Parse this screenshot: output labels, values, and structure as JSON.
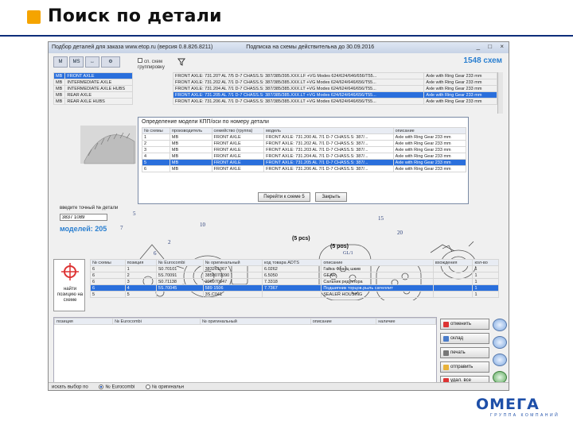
{
  "slide": {
    "title": "Поиск по детали"
  },
  "window": {
    "title": "Подбор деталей для заказа www.etop.ru (версия 0.8.826.8211)",
    "subtitle": "Подписка на схемы действительна до 30.09.2016",
    "controls": "_ □ ×",
    "schemes_count": "1548 схем",
    "checkbox_label": "сп. схем группировку",
    "toolbar": [
      "M",
      "MS",
      "↔",
      "⚙"
    ]
  },
  "left_list": [
    {
      "code": "MB",
      "name": "FRONT AXLE",
      "selected": true
    },
    {
      "code": "MB",
      "name": "INTERMEDIATE AXLE"
    },
    {
      "code": "MB",
      "name": "INTERMEDIATE AXLE HUBS"
    },
    {
      "code": "MB",
      "name": "REAR AXLE"
    },
    {
      "code": "MB",
      "name": "REAR AXLE HUBS"
    }
  ],
  "top_list": [
    {
      "model": "FRONT AXLE: 731.20? AL 7/5 D-7 CHASS.S: 387/385/395.XXX.LF +VG Modes 624/624/646/656/T55...",
      "desc": "Axle with Ring Gear 233 mm"
    },
    {
      "model": "FRONT AXLE: 731.202 AL 7/1 D-7 CHASS.S: 387/385/385.XXX.LT +VG Modes 624/624/646/656/T55...",
      "desc": "Axle with Ring Gear 233 mm"
    },
    {
      "model": "FRONT AXLE: 731.204 AL 7/1 D-7 CHASS.S: 387/385/385.XXX.LT +VG Modes 624/624/646/656/T55...",
      "desc": "Axle with Ring Gear 233 mm"
    },
    {
      "model": "FRONT AXLE: 731.205 AL 7/1 D-7 CHASS.S: 387/385/385.XXX.LT +VG Modes 624/624/646/656/T55...",
      "desc": "Axle with Ring Gear 233 mm",
      "selected": true
    },
    {
      "model": "FRONT AXLE: 731.206 AL 7/1 D-7 CHASS.S: 387/385/385.XXX.LT +VG Modes 624/624/646/656/T55...",
      "desc": "Axle with Ring Gear 233 mm"
    }
  ],
  "dialog": {
    "title": "Определение модели КПП/оси по номеру детали",
    "headers": [
      "№ схемы",
      "производитель",
      "семейство (группа)",
      "модель",
      "описание"
    ],
    "rows": [
      [
        "1",
        "MB",
        "FRONT AXLE",
        "FRONT AXLE: 731.200 AL 7/1 D-7 CHASS.S: 387/...",
        "Axle with Ring Gear 233 mm"
      ],
      [
        "2",
        "MB",
        "FRONT AXLE",
        "FRONT AXLE: 731.202 AL 7/1 D-7 CHASS.S: 387/...",
        "Axle with Ring Gear 233 mm"
      ],
      [
        "3",
        "MB",
        "FRONT AXLE",
        "FRONT AXLE: 731.203 AL 7/1 D-7 CHASS.S: 387/...",
        "Axle with Ring Gear 233 mm"
      ],
      [
        "4",
        "MB",
        "FRONT AXLE",
        "FRONT AXLE: 731.204 AL 7/1 D-7 CHASS.S: 387/...",
        "Axle with Ring Gear 233 mm"
      ],
      [
        "5",
        "MB",
        "FRONT AXLE",
        "FRONT AXLE: 731.205 AL 7/1 D-7 CHASS.S: 387/...",
        "Axle with Ring Gear 233 mm"
      ],
      [
        "6",
        "MB",
        "FRONT AXLE",
        "FRONT AXLE: 731.206 AL 7/1 D-7 CHASS.S: 387/...",
        "Axle with Ring Gear 233 mm"
      ]
    ],
    "selected_index": 4,
    "goto_button": "Перейти к схеме 5",
    "close_button": "Закрыть"
  },
  "search": {
    "label": "введите точный № детали",
    "value": "3837 1089",
    "models_count": "моделей: 205"
  },
  "drawing_callouts": [
    "5",
    "7",
    "10",
    "2",
    "6",
    "15",
    "20",
    "(5 pcs)",
    "(5 pos)",
    "GL/1"
  ],
  "find_box": {
    "label": "найти позицию на схеме"
  },
  "parts_grid": {
    "headers": [
      "№ схемы",
      "позиция",
      "№ Eurocombi",
      "№ оригинальный",
      "код товара ADTS",
      "описание",
      "вхождения",
      "кол-во"
    ],
    "rows": [
      [
        "6",
        "1",
        "S0.70101",
        "383261067",
        "6.0262",
        "Гайка Фланц шкив",
        "",
        "1"
      ],
      [
        "6",
        "2",
        "5S.70091",
        "3850070090",
        "6.5050",
        "GEAR",
        "",
        "1"
      ],
      [
        "6",
        "3",
        "S0.71138",
        "206970647",
        "7.3318",
        "Сальник редуктора",
        "",
        "1"
      ],
      [
        "6",
        "4",
        "5S.70045",
        "589 1506",
        "7.7367",
        "Подшипник торцов.рыль сателлит",
        "",
        "1"
      ],
      [
        "5",
        "5",
        "",
        "3S.C041",
        "",
        "SEALER HOUSING",
        "",
        "1"
      ]
    ],
    "selected_index": 3
  },
  "bottom_grid": {
    "headers": [
      "позиция",
      "№ Eurocombi",
      "№ оригинальный",
      "описание",
      "наличие"
    ]
  },
  "actions": [
    "отменить",
    "склад",
    "печать",
    "отправить",
    "удал. все"
  ],
  "status_bar": {
    "label": "искать выбор по",
    "option1": "№ Eurocombi",
    "option2": "№ оригинальн"
  },
  "logo": {
    "main": "ОМЕГА",
    "sub": "ГРУППА КОМПАНИЙ"
  },
  "colors": {
    "accent": "#f5a400",
    "selection": "#2a6fdc",
    "brand": "#1e4fa8"
  }
}
